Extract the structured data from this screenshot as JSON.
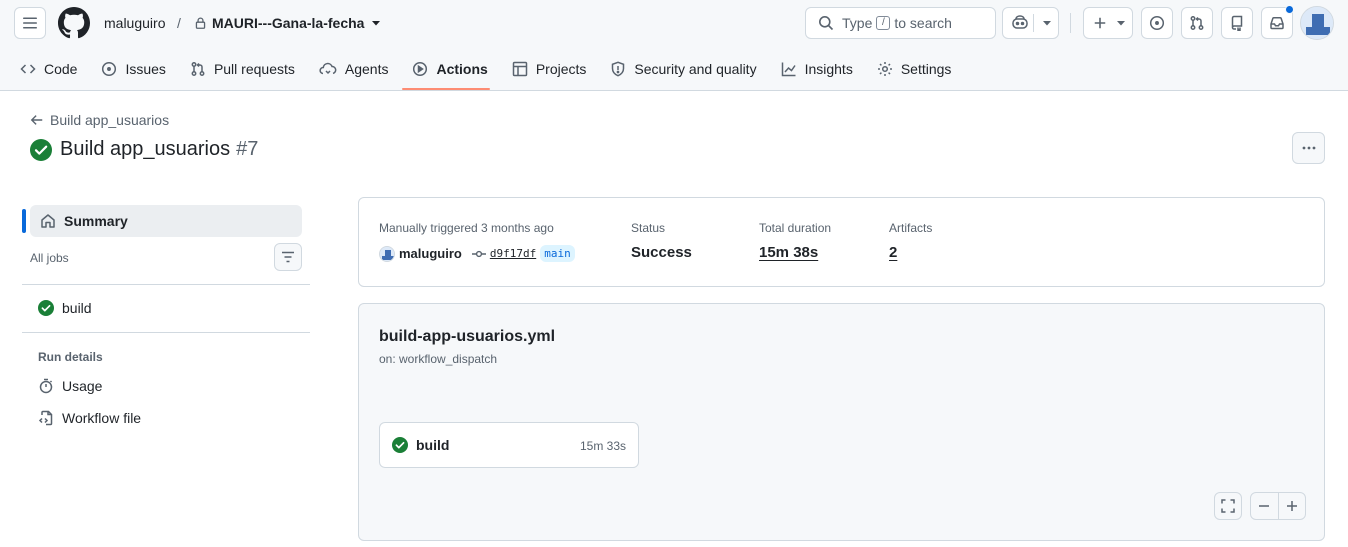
{
  "header": {
    "owner": "maluguiro",
    "separator": "/",
    "repo": "MAURI---Gana-la-fecha",
    "search_prefix": "Type",
    "search_key": "/",
    "search_suffix": "to search"
  },
  "tabs": [
    {
      "label": "Code",
      "icon": "code-icon"
    },
    {
      "label": "Issues",
      "icon": "issue-icon"
    },
    {
      "label": "Pull requests",
      "icon": "pull-request-icon"
    },
    {
      "label": "Agents",
      "icon": "agents-icon"
    },
    {
      "label": "Actions",
      "icon": "play-icon",
      "active": true
    },
    {
      "label": "Projects",
      "icon": "table-icon"
    },
    {
      "label": "Security and quality",
      "icon": "shield-icon"
    },
    {
      "label": "Insights",
      "icon": "graph-icon"
    },
    {
      "label": "Settings",
      "icon": "gear-icon"
    }
  ],
  "page": {
    "back_label": "Build app_usuarios",
    "title": "Build app_usuarios",
    "run_number": "#7"
  },
  "sidebar": {
    "summary_label": "Summary",
    "all_jobs_label": "All jobs",
    "jobs": [
      {
        "label": "build"
      }
    ],
    "run_details_label": "Run details",
    "details": [
      {
        "label": "Usage",
        "icon": "stopwatch-icon"
      },
      {
        "label": "Workflow file",
        "icon": "file-code-icon"
      }
    ]
  },
  "summary": {
    "trigger_text": "Manually triggered 3 months ago",
    "actor": "maluguiro",
    "commit": "d9f17df",
    "branch": "main",
    "status_label": "Status",
    "status_value": "Success",
    "duration_label": "Total duration",
    "duration_value": "15m 38s",
    "artifacts_label": "Artifacts",
    "artifacts_value": "2"
  },
  "workflow": {
    "file": "build-app-usuarios.yml",
    "trigger": "on: workflow_dispatch",
    "job_name": "build",
    "job_duration": "15m 33s"
  },
  "colors": {
    "success": "#1a7f37",
    "accent": "#0969da",
    "tab_underline": "#fd8c73"
  }
}
